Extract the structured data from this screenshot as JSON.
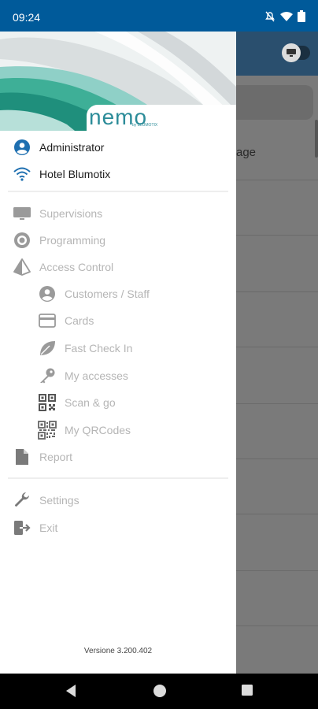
{
  "status_bar": {
    "time": "09:24",
    "icons": [
      "mute-icon",
      "wifi-icon",
      "battery-icon"
    ]
  },
  "drawer": {
    "logo": {
      "text": "nemo",
      "subtext": "by BLUMOTIX"
    },
    "account": [
      {
        "label": "Administrator",
        "icon": "account-circle-icon"
      },
      {
        "label": "Hotel Blumotix",
        "icon": "wifi-icon"
      }
    ],
    "menu": [
      {
        "label": "Supervisions",
        "icon": "monitor-icon"
      },
      {
        "label": "Programming",
        "icon": "target-icon"
      },
      {
        "label": "Access Control",
        "icon": "pyramid-icon"
      },
      {
        "label": "Customers / Staff",
        "icon": "account-icon"
      },
      {
        "label": "Cards",
        "icon": "card-icon"
      },
      {
        "label": "Fast Check In",
        "icon": "leaf-icon"
      },
      {
        "label": "My accesses",
        "icon": "key-icon"
      },
      {
        "label": "Scan & go",
        "icon": "qr-scan-icon"
      },
      {
        "label": "My QRCodes",
        "icon": "qrcode-icon"
      },
      {
        "label": "Report",
        "icon": "document-icon"
      }
    ],
    "footer_menu": [
      {
        "label": "Settings",
        "icon": "wrench-icon"
      },
      {
        "label": "Exit",
        "icon": "exit-icon"
      }
    ],
    "version": "Versione 3.200.402"
  },
  "background_app": {
    "partial_text": "age"
  },
  "nav_bar": [
    "back-icon",
    "home-icon",
    "recents-icon"
  ],
  "colors": {
    "status_bar": "#005a9a",
    "brand": "#2c8c99",
    "icon_active": "#1e6fb0",
    "icon_inactive": "#9a9a9a"
  }
}
